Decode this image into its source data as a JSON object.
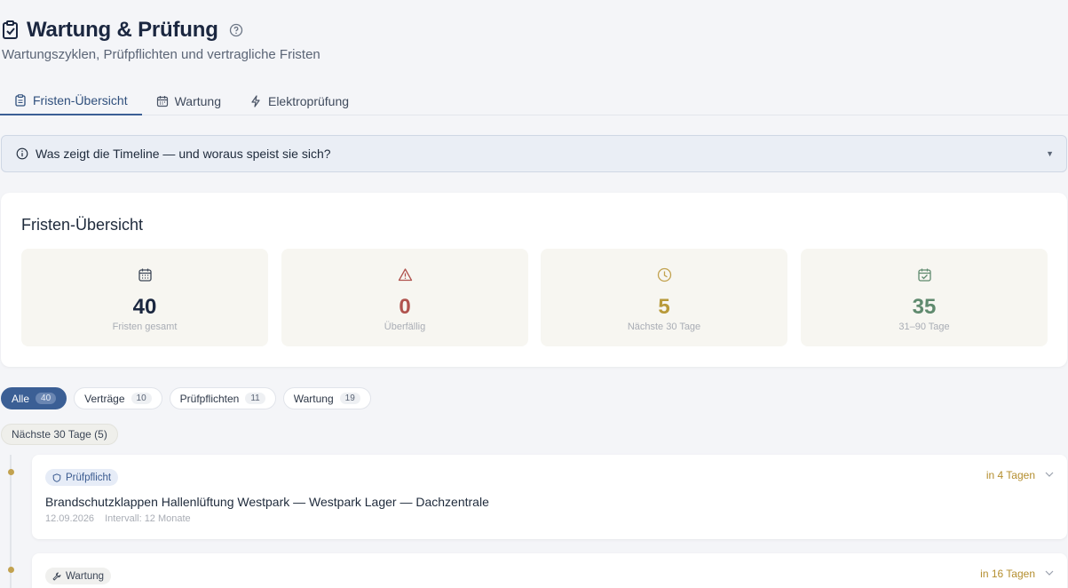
{
  "header": {
    "title": "Wartung & Prüfung",
    "subtitle": "Wartungszyklen, Prüfpflichten und vertragliche Fristen"
  },
  "tabs": [
    {
      "label": "Fristen-Übersicht",
      "icon": "clipboard-icon",
      "active": true
    },
    {
      "label": "Wartung",
      "icon": "calendar-icon",
      "active": false
    },
    {
      "label": "Elektroprüfung",
      "icon": "lightning-icon",
      "active": false
    }
  ],
  "info_panel": {
    "text": "Was zeigt die Timeline — und woraus speist sie sich?",
    "icon": "info-icon"
  },
  "overview": {
    "title": "Fristen-Übersicht",
    "stats": [
      {
        "value": "40",
        "label": "Fristen gesamt",
        "icon": "calendar-icon",
        "color": "#1b2740"
      },
      {
        "value": "0",
        "label": "Überfällig",
        "icon": "warning-icon",
        "color": "#b0534e"
      },
      {
        "value": "5",
        "label": "Nächste 30 Tage",
        "icon": "clock-icon",
        "color": "#b89a3a"
      },
      {
        "value": "35",
        "label": "31–90 Tage",
        "icon": "calendar-check-icon",
        "color": "#5f8a6e"
      }
    ]
  },
  "filters": [
    {
      "label": "Alle",
      "count": "40",
      "active": true
    },
    {
      "label": "Verträge",
      "count": "10",
      "active": false
    },
    {
      "label": "Prüfpflichten",
      "count": "11",
      "active": false
    },
    {
      "label": "Wartung",
      "count": "19",
      "active": false
    }
  ],
  "section_label": "Nächste 30 Tage (5)",
  "items": [
    {
      "badge": "Prüfpflicht",
      "badge_icon": "shield-icon",
      "title": "Brandschutzklappen Hallenlüftung Westpark — Westpark Lager — Dachzentrale",
      "date": "12.09.2026",
      "interval": "Intervall: 12 Monate",
      "due": "in 4 Tagen"
    },
    {
      "badge": "Wartung",
      "badge_icon": "wrench-icon",
      "due": "in 16 Tagen"
    }
  ],
  "colors": {
    "accent": "#3b5f95",
    "due": "#b48e2e"
  }
}
